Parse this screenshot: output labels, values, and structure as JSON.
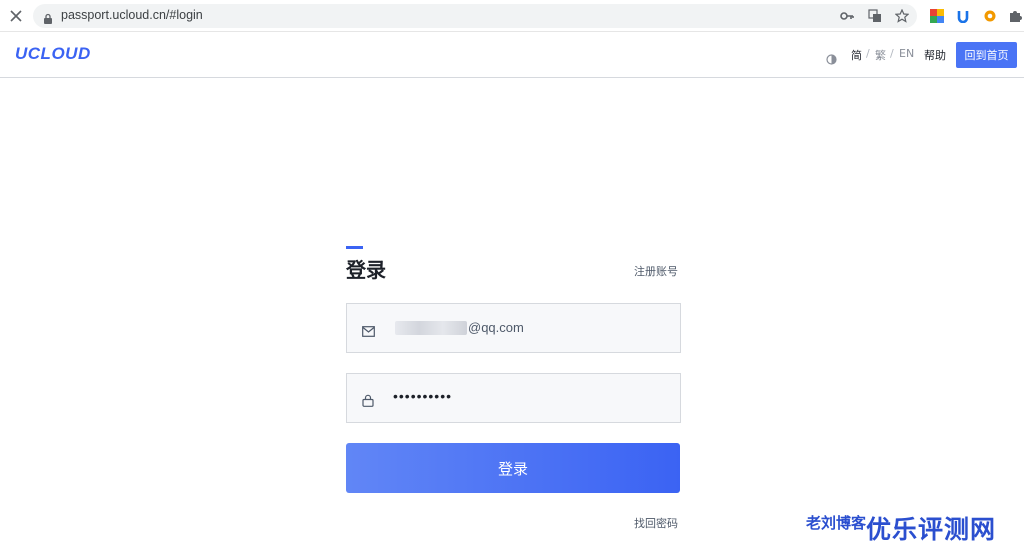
{
  "browser": {
    "url": "passport.ucloud.cn/#login"
  },
  "header": {
    "logo": "UCLOUD",
    "languages": [
      {
        "label": "简",
        "active": true
      },
      {
        "label": "繁",
        "active": false
      },
      {
        "label": "EN",
        "active": false
      }
    ],
    "separator": "/",
    "help_label": "帮助",
    "home_button": "回到首页"
  },
  "login": {
    "title": "登录",
    "register_link": "注册账号",
    "email_value": "@qq.com",
    "password_value": "••••••••••",
    "submit_label": "登录",
    "forgot_link": "找回密码"
  },
  "watermark": {
    "small": "老刘博客",
    "large": "优乐评测网"
  },
  "colors": {
    "accent": "#3b63f3",
    "button": "#4a74f5",
    "field_bg": "#f7f8fa"
  }
}
